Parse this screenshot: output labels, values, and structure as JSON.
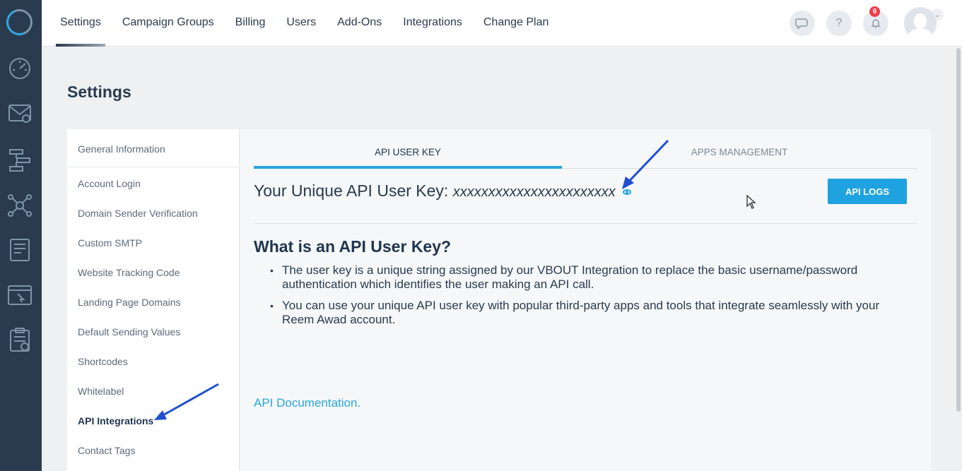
{
  "nav": {
    "items": [
      "Settings",
      "Campaign Groups",
      "Billing",
      "Users",
      "Add-Ons",
      "Integrations",
      "Change Plan"
    ],
    "active": "Settings"
  },
  "header": {
    "help_label": "?",
    "notifications_count": "6"
  },
  "page_title": "Settings",
  "sidebar": {
    "general": "General Information",
    "items": [
      "Account Login",
      "Domain Sender Verification",
      "Custom SMTP",
      "Website Tracking Code",
      "Landing Page Domains",
      "Default Sending Values",
      "Shortcodes",
      "Whitelabel",
      "API Integrations",
      "Contact Tags"
    ],
    "active": "API Integrations"
  },
  "tabs": {
    "user_key": "API USER KEY",
    "apps": "APPS MANAGEMENT"
  },
  "api": {
    "key_label": "Your Unique API User Key:",
    "key_value": "xxxxxxxxxxxxxxxxxxxxxxx",
    "logs_button": "API LOGS",
    "what_heading": "What is an API User Key?",
    "bullets": [
      "The user key is a unique string assigned by our VBOUT Integration to replace the basic username/password authentication which identifies the user making an API call.",
      "You can use your unique API user key with popular third-party apps and tools that integrate seamlessly with your Reem Awad account."
    ],
    "doc_link": "API Documentation."
  },
  "colors": {
    "rail": "#2a3b4f",
    "accent": "#2aa6e0",
    "badge": "#ef3b4a"
  }
}
